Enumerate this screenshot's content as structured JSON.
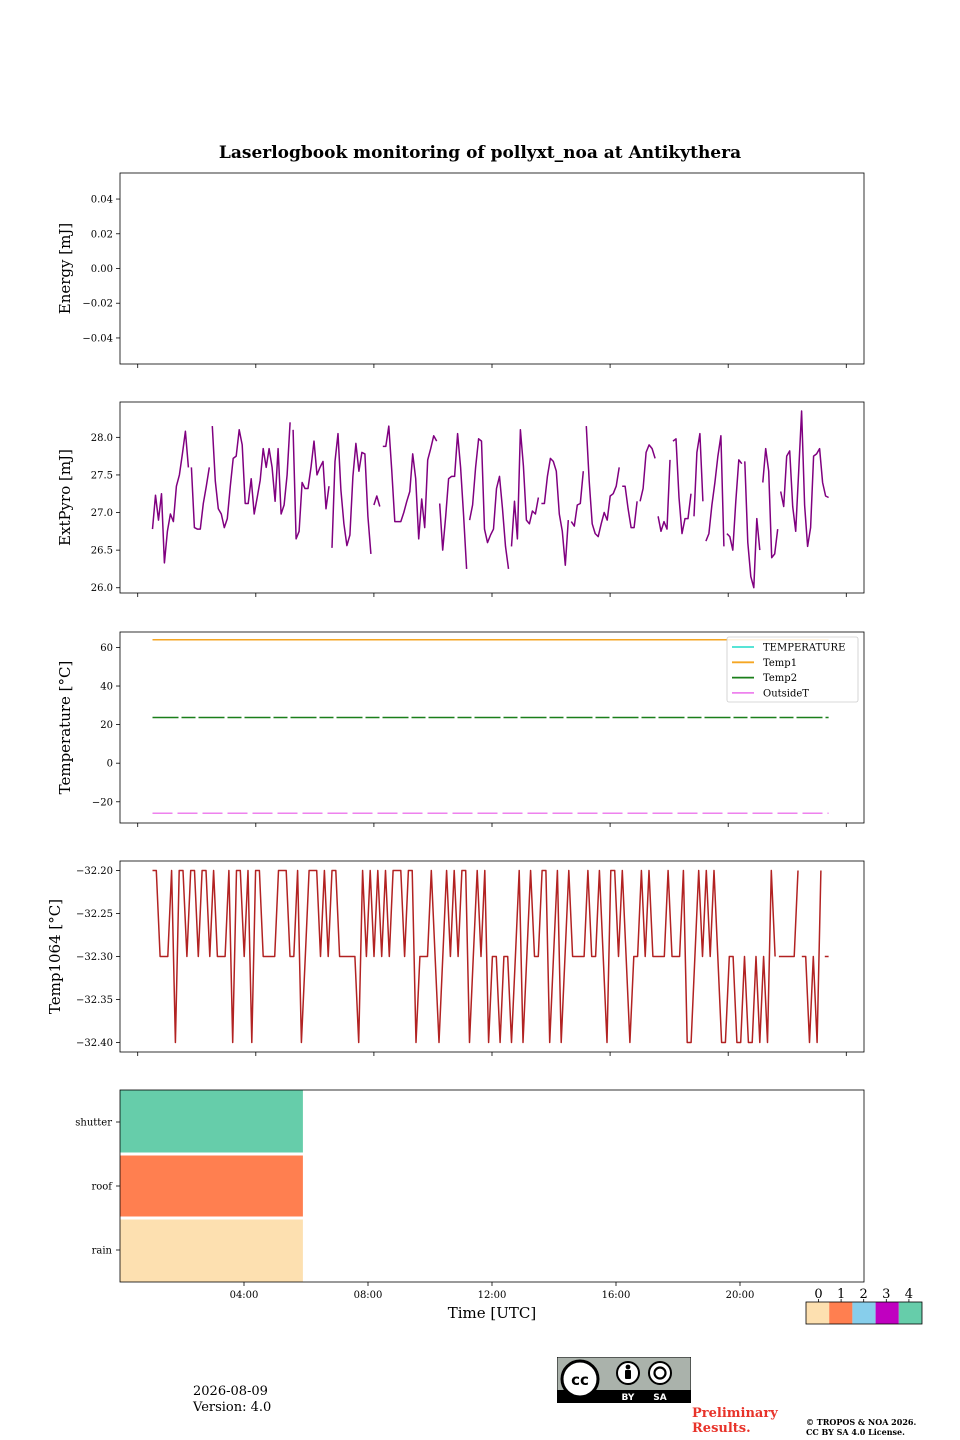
{
  "title": "Laserlogbook monitoring of pollyxt_noa at Antikythera",
  "footer": {
    "date": "2026-08-09",
    "version": "Version: 4.0",
    "preliminary_line1": "Preliminary",
    "preliminary_line2": "Results.",
    "copyright_line1": "© TROPOS & NOA 2026.",
    "copyright_line2": "CC BY SA 4.0 License.",
    "license_badge": {
      "by": "BY",
      "sa": "SA"
    }
  },
  "colorbar": {
    "labels": [
      "0",
      "1",
      "2",
      "3",
      "4"
    ],
    "colors": [
      "#fde0b0",
      "#ff7f50",
      "#87ceeb",
      "#c000c0",
      "#66cdaa"
    ]
  },
  "colors": {
    "extpyro": "#800080",
    "temperature": "#40e0d0",
    "temp1": "#f5a623",
    "temp2": "#1a7f1a",
    "outsidet": "#ee82ee",
    "temp1064": "#b22222"
  },
  "chart_data": [
    {
      "type": "line",
      "ylabel": "Energy [mJ]",
      "ylim": [
        -0.055,
        0.055
      ],
      "yticks": [
        0.04,
        0.02,
        0.0,
        -0.02,
        -0.04
      ],
      "ytick_labels": [
        "0.04",
        "0.02",
        "0.00",
        "−0.02",
        "−0.04"
      ],
      "series": []
    },
    {
      "type": "line",
      "ylabel": "ExtPyro [mJ]",
      "ylim": [
        25.93,
        28.47
      ],
      "yticks": [
        26.0,
        26.5,
        27.0,
        27.5,
        28.0
      ],
      "ytick_labels": [
        "26.0",
        "26.5",
        "27.0",
        "27.5",
        "28.0"
      ],
      "xlim_hours": [
        -0.6,
        24.6
      ],
      "x_start_hour": 0.5,
      "x_end_hour": 23.4,
      "series": [
        {
          "values": [
            26.78,
            27.23,
            26.9,
            27.25,
            26.33,
            26.75,
            26.98,
            26.88,
            27.35,
            27.5,
            27.78,
            28.08,
            27.6,
            27.6,
            26.8,
            26.78,
            26.78,
            27.12,
            27.35,
            27.6,
            28.15,
            27.42,
            27.05,
            26.98,
            26.8,
            26.92,
            27.35,
            27.72,
            27.75,
            28.1,
            27.9,
            27.12,
            27.12,
            27.45,
            26.98,
            27.2,
            27.43,
            27.85,
            27.6,
            27.85,
            27.6,
            27.15,
            27.85,
            26.98,
            27.1,
            27.5,
            28.2,
            28.1,
            26.65,
            26.75,
            27.4,
            27.32,
            27.32,
            27.6,
            27.95,
            27.5,
            27.6,
            27.68,
            27.05,
            27.35,
            26.53,
            27.68,
            28.05,
            27.3,
            26.85,
            26.56,
            26.7,
            27.48,
            27.92,
            27.55,
            27.8,
            27.78,
            26.95,
            26.45,
            27.1,
            27.22,
            27.08,
            27.88,
            27.88,
            28.15,
            27.55,
            26.88,
            26.88,
            26.88,
            27.0,
            27.15,
            27.28,
            27.78,
            27.45,
            26.65,
            27.18,
            26.8,
            27.7,
            27.85,
            28.02,
            27.95,
            27.12,
            26.5,
            26.95,
            27.45,
            27.48,
            27.48,
            28.05,
            27.6,
            26.96,
            26.25,
            26.9,
            27.1,
            27.6,
            27.98,
            27.95,
            26.78,
            26.6,
            26.7,
            26.78,
            27.32,
            27.48,
            27.05,
            26.55,
            26.25,
            26.55,
            27.15,
            26.65,
            28.1,
            27.62,
            26.9,
            26.85,
            27.02,
            26.98,
            27.2,
            27.12,
            27.12,
            27.48,
            27.72,
            27.68,
            27.55,
            26.98,
            26.75,
            26.3,
            26.9,
            26.88,
            26.82,
            27.1,
            27.12,
            27.55,
            28.15,
            27.42,
            26.85,
            26.72,
            26.68,
            26.85,
            27.0,
            26.9,
            27.22,
            27.25,
            27.35,
            27.6,
            27.35,
            27.35,
            27.05,
            26.8,
            26.8,
            27.15,
            27.15,
            27.32,
            27.8,
            27.9,
            27.85,
            27.72,
            26.95,
            26.75,
            26.88,
            26.78,
            27.7,
            27.95,
            27.98,
            27.2,
            26.72,
            26.92,
            26.92,
            27.25,
            26.95,
            27.8,
            28.05,
            27.15,
            26.62,
            26.72,
            27.1,
            27.4,
            27.75,
            28.02,
            26.55,
            26.72,
            26.68,
            26.5,
            27.15,
            27.7,
            27.65,
            27.68,
            26.6,
            26.15,
            26.0,
            26.92,
            26.5,
            27.4,
            27.85,
            27.55,
            26.4,
            26.45,
            26.78,
            27.28,
            27.08,
            27.75,
            27.82,
            27.08,
            26.75,
            27.55,
            28.35,
            27.1,
            26.55,
            26.8,
            27.75,
            27.78,
            27.85,
            27.4,
            27.22,
            27.2
          ],
          "gaps_before": [
            13,
            20,
            47,
            60,
            74,
            77,
            96,
            106,
            120,
            130,
            140,
            145,
            157,
            163,
            169,
            174,
            181,
            185,
            192,
            198,
            204,
            210
          ]
        }
      ]
    },
    {
      "type": "line",
      "ylabel": "Temperature [°C]",
      "ylim": [
        -31,
        68
      ],
      "yticks": [
        60,
        40,
        20,
        0,
        -20
      ],
      "ytick_labels": [
        "60",
        "40",
        "20",
        "0",
        "−20"
      ],
      "xlim_hours": [
        -0.6,
        24.6
      ],
      "legend": {
        "placement": "upper right",
        "entries": [
          "TEMPERATURE",
          "Temp1",
          "Temp2",
          "OutsideT"
        ]
      },
      "series": [
        {
          "name": "TEMPERATURE",
          "x": [],
          "values": []
        },
        {
          "name": "Temp1",
          "x": [
            0.5,
            23.4
          ],
          "values": [
            64.0,
            64.0
          ]
        },
        {
          "name": "Temp2",
          "x": [
            0.5,
            23.4
          ],
          "values": [
            23.7,
            23.7
          ]
        },
        {
          "name": "OutsideT",
          "x": [
            0.5,
            23.4
          ],
          "values": [
            -25.9,
            -25.9
          ]
        }
      ]
    },
    {
      "type": "line",
      "ylabel": "Temp1064 [°C]",
      "ylim": [
        -32.411,
        -32.189
      ],
      "yticks": [
        -32.2,
        -32.25,
        -32.3,
        -32.35,
        -32.4
      ],
      "ytick_labels": [
        "−32.20",
        "−32.25",
        "−32.30",
        "−32.35",
        "−32.40"
      ],
      "xlim_hours": [
        -0.6,
        24.6
      ],
      "x_start_hour": 0.5,
      "x_end_hour": 23.4,
      "series": [
        {
          "values": [
            -32.2,
            -32.2,
            -32.3,
            -32.3,
            -32.3,
            -32.2,
            -32.4,
            -32.2,
            -32.2,
            -32.3,
            -32.2,
            -32.2,
            -32.3,
            -32.2,
            -32.2,
            -32.3,
            -32.2,
            -32.3,
            -32.3,
            -32.3,
            -32.2,
            -32.4,
            -32.2,
            -32.2,
            -32.3,
            -32.2,
            -32.4,
            -32.2,
            -32.2,
            -32.3,
            -32.3,
            -32.3,
            -32.3,
            -32.2,
            -32.2,
            -32.2,
            -32.3,
            -32.3,
            -32.2,
            -32.4,
            -32.3,
            -32.2,
            -32.2,
            -32.2,
            -32.3,
            -32.2,
            -32.3,
            -32.2,
            -32.2,
            -32.3,
            -32.3,
            -32.3,
            -32.3,
            -32.3,
            -32.4,
            -32.2,
            -32.3,
            -32.2,
            -32.3,
            -32.2,
            -32.3,
            -32.2,
            -32.3,
            -32.2,
            -32.2,
            -32.2,
            -32.3,
            -32.2,
            -32.2,
            -32.4,
            -32.3,
            -32.3,
            -32.3,
            -32.2,
            -32.3,
            -32.4,
            -32.3,
            -32.2,
            -32.3,
            -32.2,
            -32.3,
            -32.2,
            -32.2,
            -32.4,
            -32.3,
            -32.2,
            -32.3,
            -32.2,
            -32.4,
            -32.3,
            -32.3,
            -32.4,
            -32.3,
            -32.3,
            -32.4,
            -32.3,
            -32.2,
            -32.4,
            -32.3,
            -32.2,
            -32.3,
            -32.3,
            -32.2,
            -32.2,
            -32.4,
            -32.3,
            -32.2,
            -32.4,
            -32.3,
            -32.2,
            -32.3,
            -32.3,
            -32.3,
            -32.3,
            -32.2,
            -32.3,
            -32.3,
            -32.2,
            -32.3,
            -32.4,
            -32.2,
            -32.2,
            -32.3,
            -32.2,
            -32.3,
            -32.4,
            -32.3,
            -32.3,
            -32.2,
            -32.3,
            -32.2,
            -32.3,
            -32.3,
            -32.3,
            -32.3,
            -32.2,
            -32.3,
            -32.3,
            -32.3,
            -32.2,
            -32.4,
            -32.4,
            -32.3,
            -32.2,
            -32.3,
            -32.2,
            -32.3,
            -32.2,
            -32.3,
            -32.4,
            -32.4,
            -32.3,
            -32.3,
            -32.4,
            -32.4,
            -32.3,
            -32.4,
            -32.4,
            -32.3,
            -32.4,
            -32.3,
            -32.4,
            -32.2,
            -32.3,
            -32.3,
            -32.3,
            -32.3,
            -32.3,
            -32.3,
            -32.2,
            -32.3,
            -32.3,
            -32.4,
            -32.3,
            -32.4,
            -32.2,
            -32.3,
            -32.3
          ],
          "gaps_before": [
            164,
            170,
            176
          ]
        }
      ]
    },
    {
      "type": "heatmap",
      "row_labels": [
        "shutter",
        "roof",
        "rain"
      ],
      "row_class_values": [
        4,
        1,
        0
      ],
      "x_covered_hours": [
        -2.0,
        3.9
      ],
      "xlim_hours": [
        -2.0,
        22.0
      ],
      "xticks_hours": [
        2,
        6,
        10,
        14,
        18
      ],
      "xtick_labels": [
        "04:00",
        "08:00",
        "12:00",
        "16:00",
        "20:00"
      ],
      "xlabel": "Time [UTC]"
    }
  ]
}
